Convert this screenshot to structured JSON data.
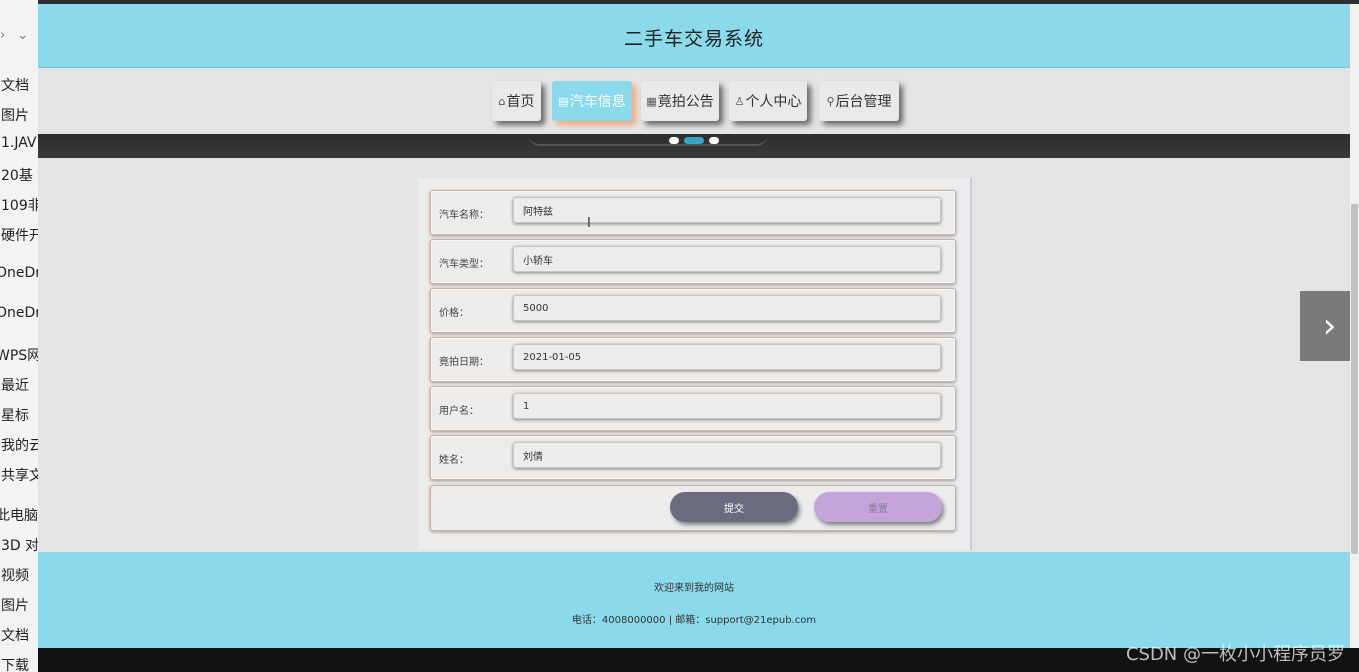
{
  "sidebar": {
    "items": [
      "文档",
      "图片",
      "1.JAV",
      "20基",
      "109非",
      "硬件开",
      "OneDr",
      "OneDr",
      "WPS网",
      "最近",
      "星标",
      "我的云",
      "共享文",
      "此电脑",
      "3D 对",
      "视频",
      "图片",
      "文档",
      "下载"
    ]
  },
  "header": {
    "title": "二手车交易系统"
  },
  "nav": {
    "items": [
      {
        "icon": "home-icon",
        "glyph": "⌂",
        "label": "首页"
      },
      {
        "icon": "list-icon",
        "glyph": "▤",
        "label": "汽车信息"
      },
      {
        "icon": "calendar-icon",
        "glyph": "▦",
        "label": "竟拍公告"
      },
      {
        "icon": "user-icon",
        "glyph": "♙",
        "label": "个人中心"
      },
      {
        "icon": "link-icon",
        "glyph": "⚲",
        "label": "后台管理"
      }
    ],
    "active_index": 1
  },
  "carousel": {
    "dot_count": 3,
    "active_dot": 1
  },
  "form": {
    "fields": [
      {
        "label": "汽车名称：",
        "value": "阿特兹"
      },
      {
        "label": "汽车类型：",
        "value": "小轿车"
      },
      {
        "label": "价格：",
        "value": "5000"
      },
      {
        "label": "竟拍日期：",
        "value": "2021-01-05"
      },
      {
        "label": "用户名：",
        "value": "1"
      },
      {
        "label": "姓名：",
        "value": "刘倩"
      }
    ],
    "submit_label": "提交",
    "reset_label": "重置"
  },
  "footer": {
    "welcome": "欢迎来到我的网站",
    "contact": "电话：4008000000 | 邮箱：support@21epub.com"
  },
  "watermark": "CSDN @一枚小小程序员罗",
  "colors": {
    "header_bg": "#8bdaec",
    "nav_active_shadow": "#f1a87e",
    "submit_bg": "#6b6b80",
    "reset_bg": "#c3a5db"
  }
}
